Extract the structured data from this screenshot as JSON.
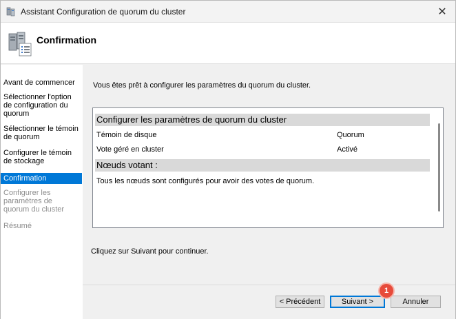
{
  "window": {
    "title": "Assistant Configuration de quorum du cluster"
  },
  "header": {
    "title": "Confirmation"
  },
  "sidebar": {
    "items": [
      {
        "label": "Avant de commencer"
      },
      {
        "label": "Sélectionner l'option de configuration du quorum"
      },
      {
        "label": "Sélectionner le témoin de quorum"
      },
      {
        "label": "Configurer le témoin de stockage"
      },
      {
        "label": "Confirmation"
      },
      {
        "label": "Configurer les paramètres de quorum du cluster"
      },
      {
        "label": "Résumé"
      }
    ]
  },
  "main": {
    "intro": "Vous êtes prêt à configurer les paramètres du quorum du cluster.",
    "summary": {
      "section1_title": "Configurer les paramètres de quorum du cluster",
      "rows": [
        {
          "label": "Témoin de disque",
          "value": "Quorum"
        },
        {
          "label": "Vote géré en cluster",
          "value": "Activé"
        }
      ],
      "section2_title": "Nœuds votant :",
      "section2_text": "Tous les nœuds sont configurés pour avoir des votes de quorum."
    },
    "footer_text": "Cliquez sur Suivant pour continuer."
  },
  "buttons": {
    "previous": "< Précédent",
    "next": "Suivant >",
    "cancel": "Annuler"
  },
  "annotation": {
    "badge": "1",
    "color": "#e74b3b"
  },
  "colors": {
    "accent": "#0078d7"
  }
}
